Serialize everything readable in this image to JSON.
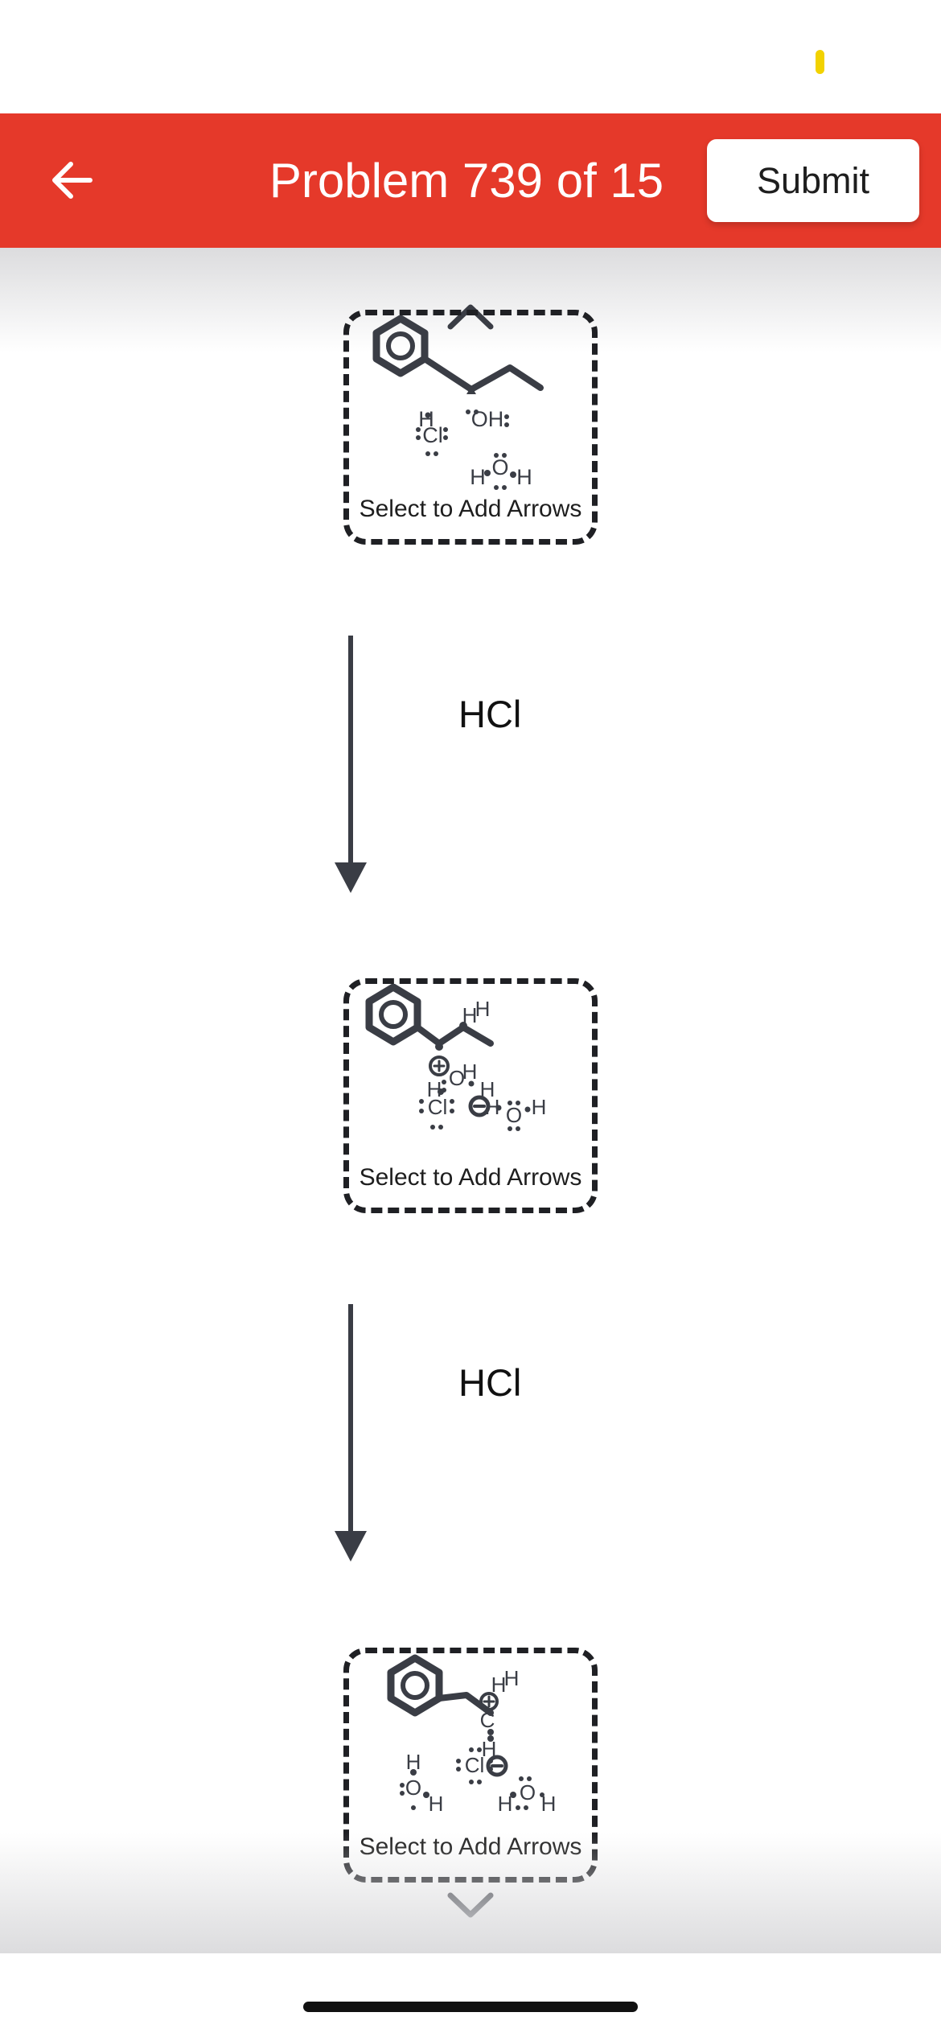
{
  "header": {
    "title": "Problem 739 of 15",
    "submit_label": "Submit",
    "back_icon": "arrow-left-icon",
    "background_color": "#e5392a"
  },
  "steps": [
    {
      "label": "Select to Add Arrows",
      "atoms": [
        "H",
        "Cl",
        "OH",
        "H",
        "O",
        "H"
      ]
    },
    {
      "label": "Select to Add Arrows",
      "atoms": [
        "H",
        "H",
        "O",
        "H",
        "H",
        "H",
        "Cl",
        "H",
        "O",
        "H"
      ]
    },
    {
      "label": "Select to Add Arrows",
      "atoms": [
        "H",
        "H",
        "C",
        "H",
        "H",
        "O",
        "H",
        "Cl",
        "H",
        "O",
        "H"
      ]
    }
  ],
  "arrows": [
    {
      "reagent": "HCl"
    },
    {
      "reagent": "HCl"
    }
  ],
  "icons": {
    "scroll_up": "chevron-up-icon",
    "scroll_down": "chevron-down-icon"
  },
  "colors": {
    "accent": "#e5392a",
    "molecule": "#3a3d45",
    "status_indicator": "#f2d200"
  }
}
